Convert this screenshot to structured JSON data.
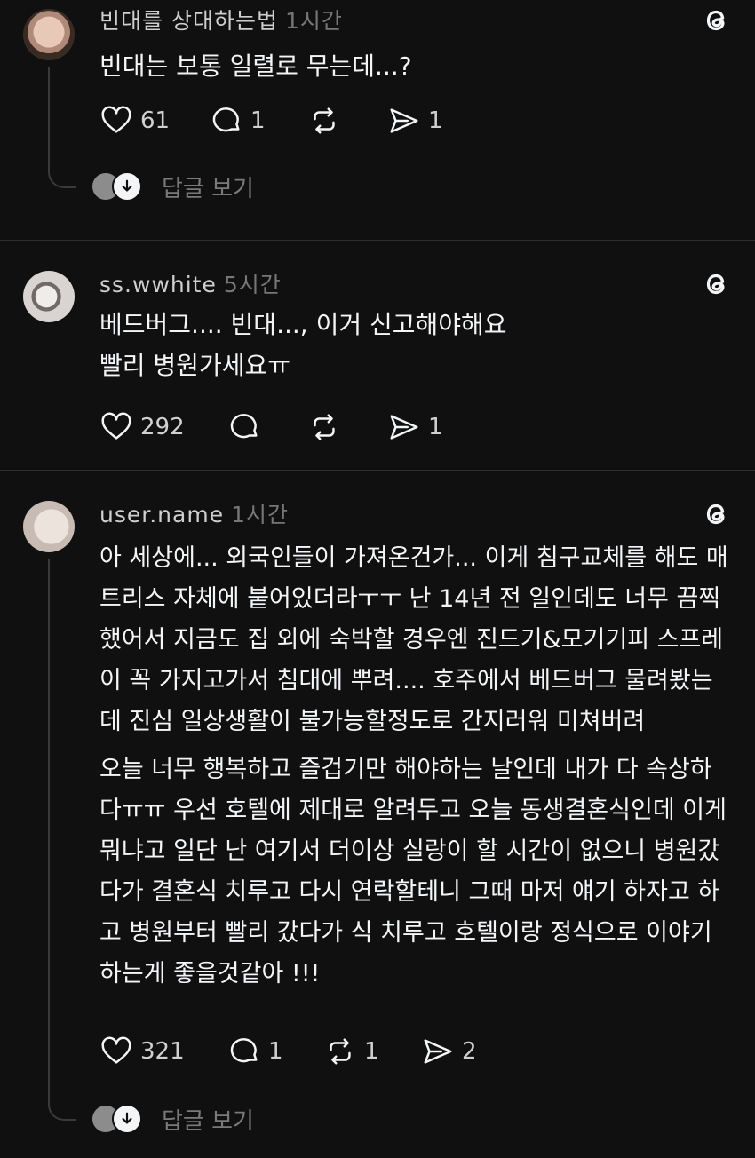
{
  "comments": [
    {
      "username": "빈대를 상대하는법",
      "time": "1시간",
      "paragraphs": [
        "빈대는 보통 일렬로 무는데...?"
      ],
      "likes": "61",
      "replies": "1",
      "reposts": "",
      "shares": "1",
      "view_replies": "답글 보기"
    },
    {
      "username": "ss.wwhite",
      "time": "5시간",
      "paragraphs": [
        "베드버그.... 빈대..., 이거 신고해야해요",
        "빨리 병원가세요ㅠ"
      ],
      "likes": "292",
      "replies": "",
      "reposts": "",
      "shares": "1"
    },
    {
      "username": "user.name",
      "time": "1시간",
      "paragraphs": [
        "아 세상에... 외국인들이 가져온건가... 이게 침구교체를 해도 매트리스 자체에 붙어있더라ㅜㅜ 난 14년 전 일인데도 너무 끔찍했어서 지금도 집 외에 숙박할 경우엔 진드기&모기기피 스프레이 꼭 가지고가서 침대에 뿌려.... 호주에서 베드버그 물려봤는데 진심 일상생활이 불가능할정도로 간지러워 미쳐버려",
        "오늘 너무 행복하고 즐겁기만 해야하는 날인데 내가 다 속상하다ㅠㅠ 우선 호텔에 제대로 알려두고 오늘 동생결혼식인데 이게 뭐냐고 일단 난 여기서 더이상 실랑이 할 시간이 없으니 병원갔다가 결혼식 치루고 다시 연락할테니 그때 마저 얘기 하자고 하고 병원부터 빨리 갔다가 식 치루고 호텔이랑 정식으로 이야기 하는게 좋을것같아 !!!"
      ],
      "likes": "321",
      "replies": "1",
      "reposts": "1",
      "shares": "2",
      "view_replies": "답글 보기"
    }
  ],
  "icons": {
    "threads": "threads-icon",
    "like": "heart-icon",
    "reply": "speech-bubble-icon",
    "repost": "repost-icon",
    "share": "send-icon",
    "down": "arrow-down-icon"
  },
  "colors": {
    "background": "#101010",
    "text": "#f3f5f7",
    "muted": "#777777"
  }
}
